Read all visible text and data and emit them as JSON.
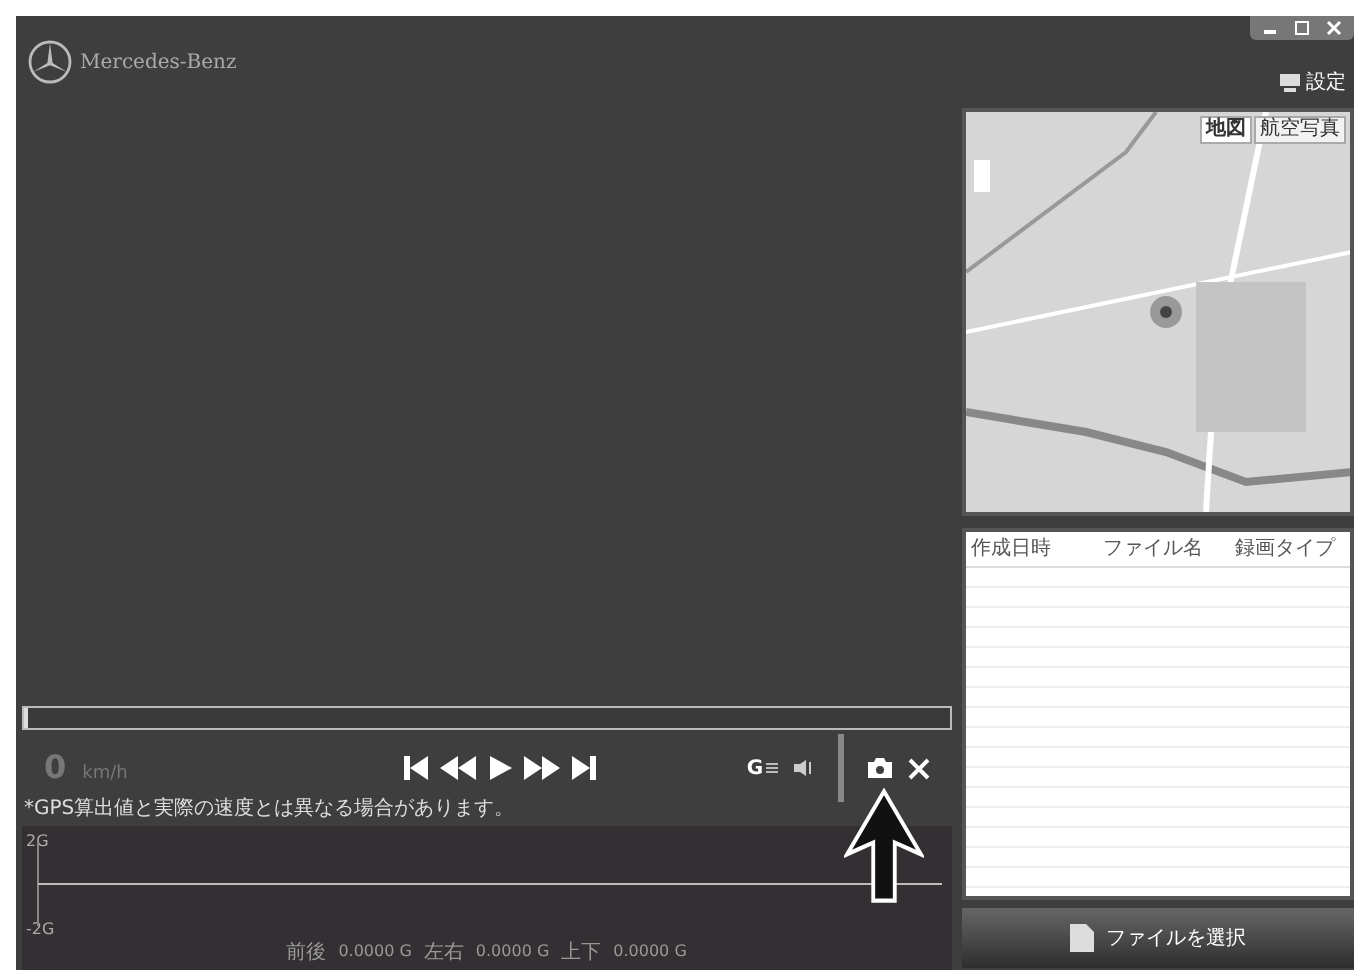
{
  "brand": {
    "name": "Mercedes-Benz"
  },
  "window_controls": [
    {
      "kind": "minimize"
    },
    {
      "kind": "maximize"
    },
    {
      "kind": "close"
    }
  ],
  "settings_button": {
    "label": "設定"
  },
  "map": {
    "buttons": [
      {
        "label": "地図",
        "selected": true
      },
      {
        "label": "航空写真",
        "selected": false
      }
    ]
  },
  "seek_bar": {
    "level": 0.0
  },
  "speed": {
    "value": "0",
    "unit": "km/h"
  },
  "gps_note": "*GPS算出値と実際の速度とは異なる場合があります。",
  "playback_buttons": [
    {
      "kind": "first"
    },
    {
      "kind": "rewind"
    },
    {
      "kind": "play"
    },
    {
      "kind": "forward"
    },
    {
      "kind": "last"
    }
  ],
  "tool_buttons": [
    {
      "kind": "gsensor",
      "label": "G"
    },
    {
      "kind": "volume"
    },
    {
      "kind": "camera"
    },
    {
      "kind": "close"
    }
  ],
  "g_chart": {
    "top_label": "2G",
    "bottom_label": "-2G",
    "readings": [
      {
        "label": "前後",
        "value": "0.0000 G"
      },
      {
        "label": "左右",
        "value": "0.0000 G"
      },
      {
        "label": "上下",
        "value": "0.0000 G"
      }
    ]
  },
  "file_table": {
    "columns": [
      "作成日時",
      "ファイル名",
      "録画タイプ"
    ]
  },
  "select_file_button": {
    "label": "ファイルを選択"
  }
}
